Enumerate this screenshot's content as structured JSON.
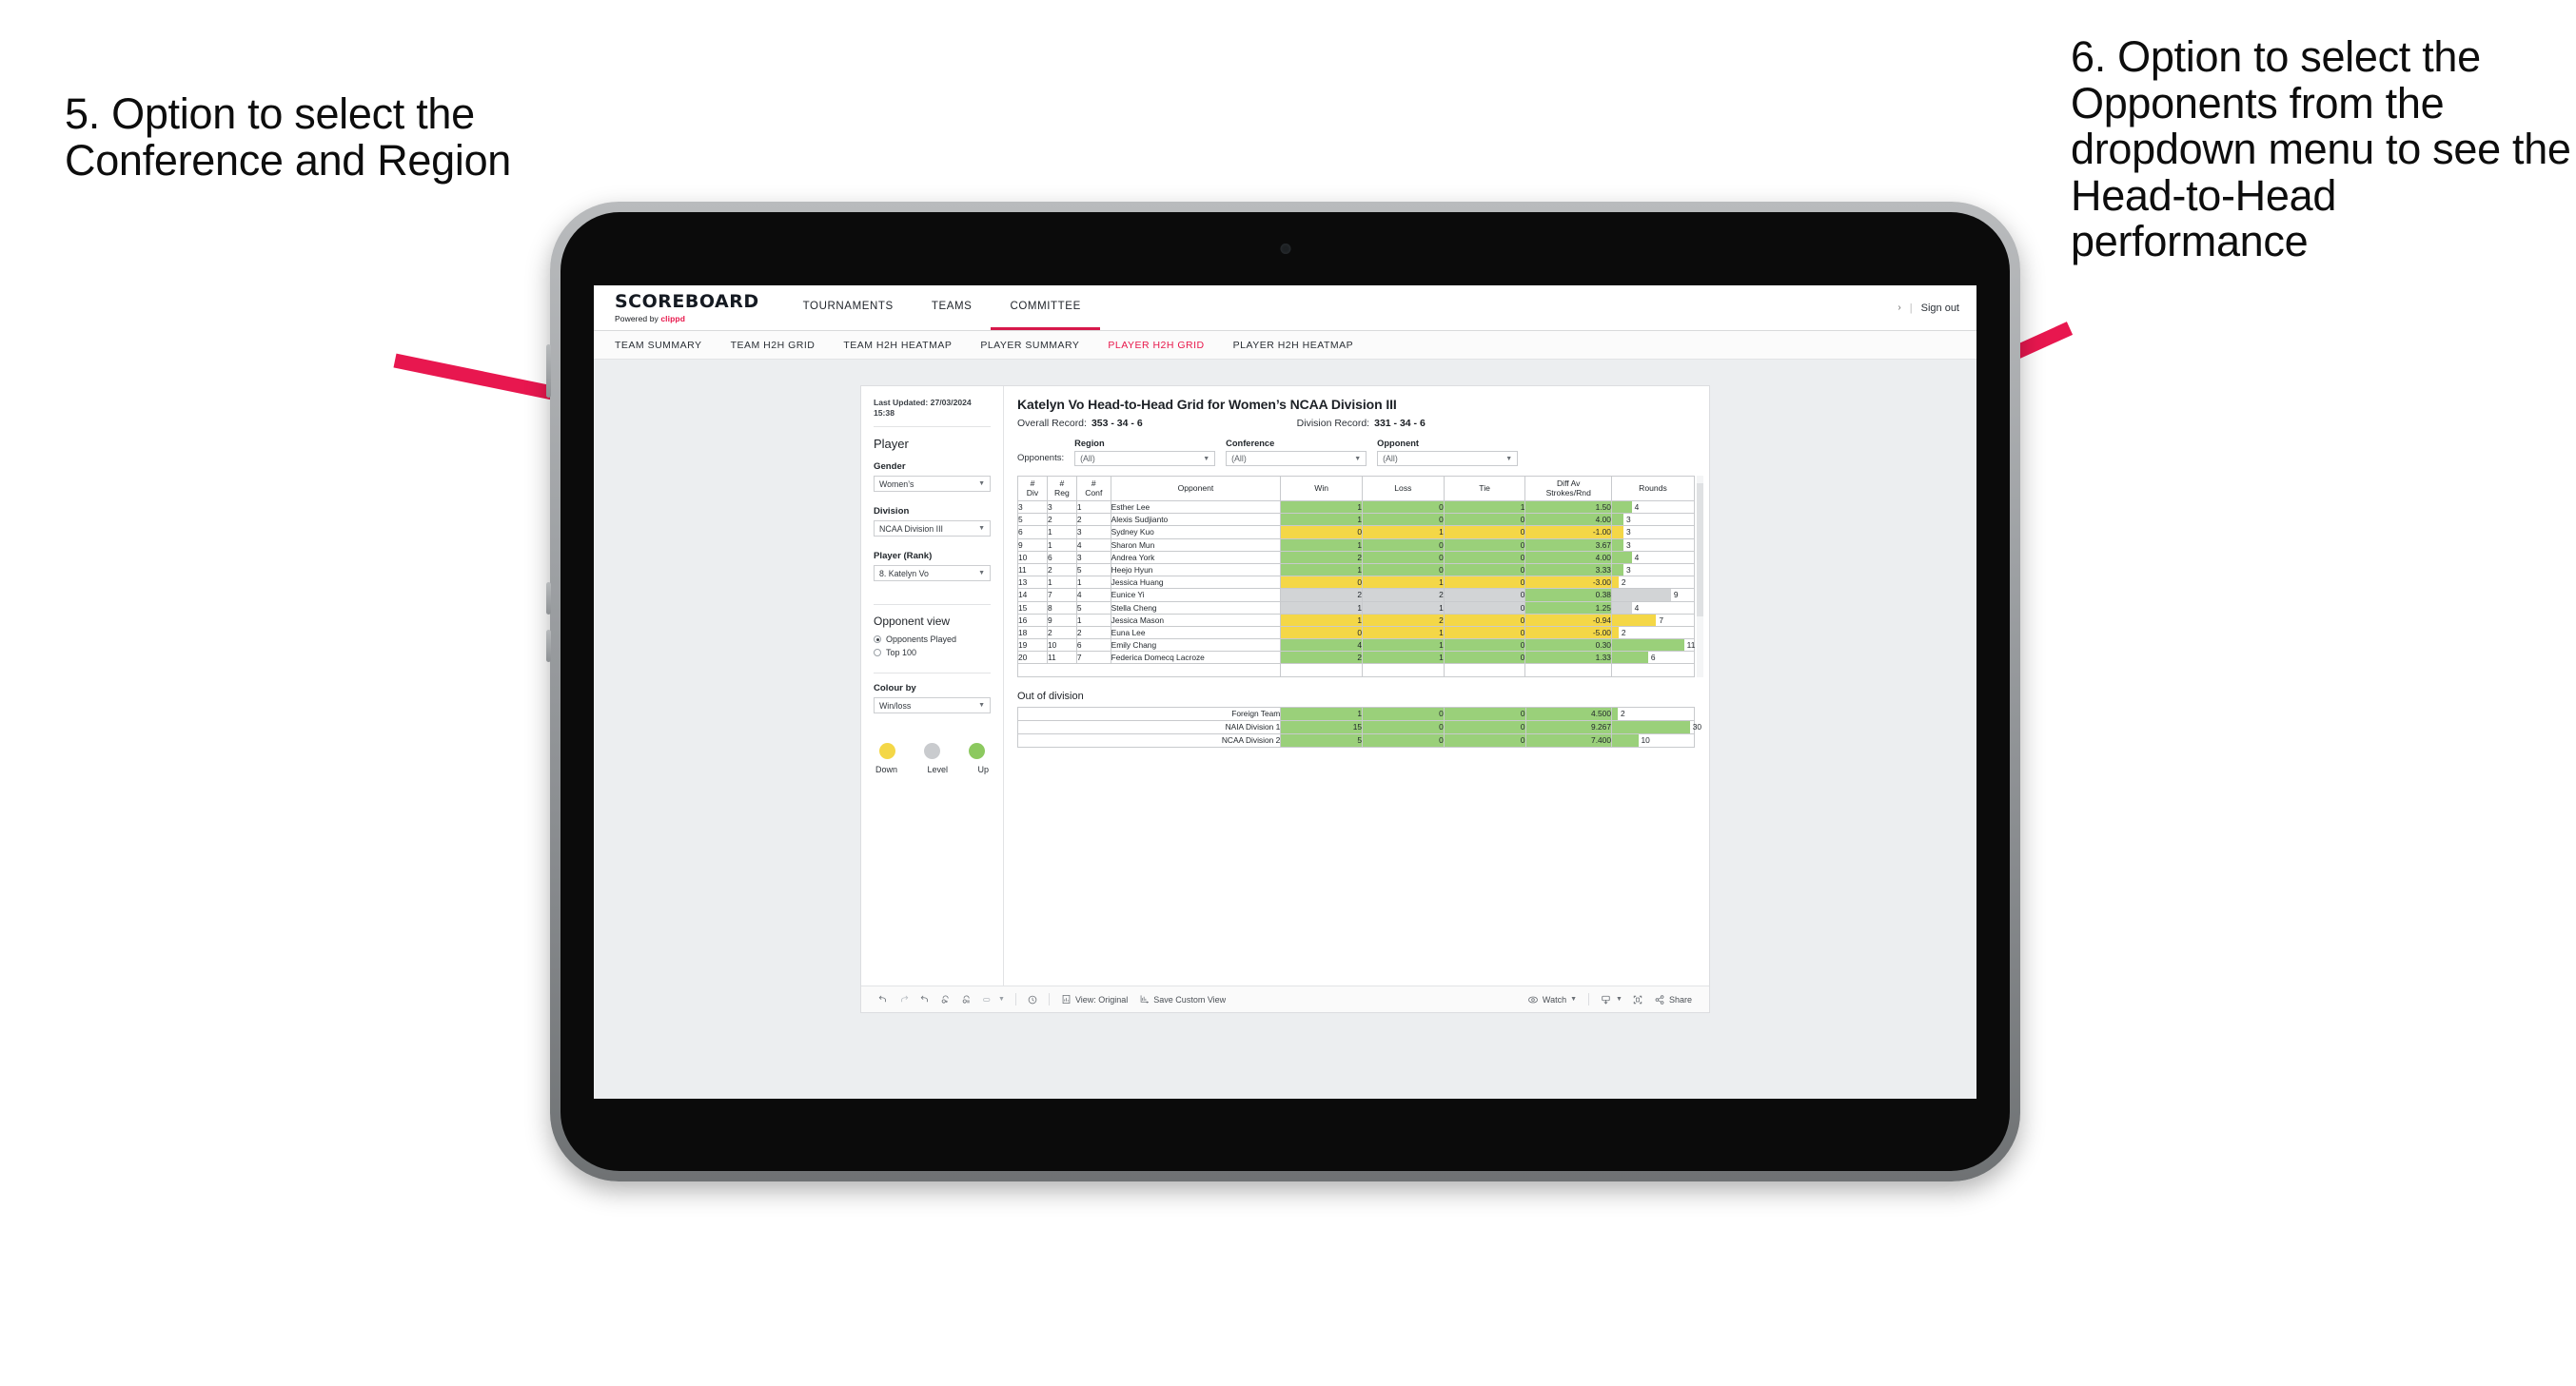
{
  "annotations": {
    "left": "5. Option to select the Conference and Region",
    "right": "6. Option to select the Opponents from the dropdown menu to see the Head-to-Head performance",
    "arrow_color": "#e8174f"
  },
  "app": {
    "brand": {
      "name": "SCOREBOARD",
      "powered_prefix": "Powered by ",
      "powered_brand": "clippd"
    },
    "topnav": [
      {
        "label": "TOURNAMENTS",
        "active": false
      },
      {
        "label": "TEAMS",
        "active": false
      },
      {
        "label": "COMMITTEE",
        "active": true
      }
    ],
    "top_right": {
      "chevron": "›",
      "divider": "|",
      "signout": "Sign out"
    },
    "subnav": [
      {
        "label": "TEAM SUMMARY",
        "active": false
      },
      {
        "label": "TEAM H2H GRID",
        "active": false
      },
      {
        "label": "TEAM H2H HEATMAP",
        "active": false
      },
      {
        "label": "PLAYER SUMMARY",
        "active": false
      },
      {
        "label": "PLAYER H2H GRID",
        "active": true
      },
      {
        "label": "PLAYER H2H HEATMAP",
        "active": false
      }
    ],
    "accent": "#e8174b"
  },
  "sidebar": {
    "last_updated": "Last Updated: 27/03/2024 15:38",
    "section_player": "Player",
    "fields": [
      {
        "label": "Gender",
        "value": "Women’s"
      },
      {
        "label": "Division",
        "value": "NCAA Division III"
      },
      {
        "label": "Player (Rank)",
        "value": "8. Katelyn Vo"
      }
    ],
    "opponent_view": {
      "title": "Opponent view",
      "options": [
        {
          "label": "Opponents Played",
          "selected": true
        },
        {
          "label": "Top 100",
          "selected": false
        }
      ]
    },
    "colour_by": {
      "label": "Colour by",
      "value": "Win/loss"
    },
    "legend": [
      {
        "label": "Down",
        "color": "#f4d747"
      },
      {
        "label": "Level",
        "color": "#c9cbce"
      },
      {
        "label": "Up",
        "color": "#8cc95f"
      }
    ]
  },
  "main": {
    "title": "Katelyn Vo Head-to-Head Grid for Women’s NCAA Division III",
    "overall_label": "Overall Record:",
    "overall_value": "353 - 34 - 6",
    "division_label": "Division Record:",
    "division_value": "331 -  34 - 6",
    "opponents_label": "Opponents:",
    "filters": [
      {
        "label": "Region",
        "value": "(All)"
      },
      {
        "label": "Conference",
        "value": "(All)"
      },
      {
        "label": "Opponent",
        "value": "(All)"
      }
    ]
  },
  "chart_data": {
    "type": "table",
    "title": "Katelyn Vo Head-to-Head Grid for Women’s NCAA Division III",
    "columns": [
      "# Div",
      "# Reg",
      "# Conf",
      "Opponent",
      "Win",
      "Loss",
      "Tie",
      "Diff Av Strokes/Rnd",
      "Rounds"
    ],
    "column_header_lines": [
      [
        "#",
        "Div"
      ],
      [
        "#",
        "Reg"
      ],
      [
        "#",
        "Conf"
      ],
      [
        "Opponent"
      ],
      [
        "Win"
      ],
      [
        "Loss"
      ],
      [
        "Tie"
      ],
      [
        "Diff Av",
        "Strokes/Rnd"
      ],
      [
        "Rounds"
      ]
    ],
    "rows": [
      {
        "div": "3",
        "reg": "3",
        "conf": "1",
        "opponent": "Esther Lee",
        "win": "1",
        "loss": "0",
        "tie": "1",
        "diff": "1.50",
        "rounds": "4",
        "state": "up",
        "bar_pct": 24
      },
      {
        "div": "5",
        "reg": "2",
        "conf": "2",
        "opponent": "Alexis Sudjianto",
        "win": "1",
        "loss": "0",
        "tie": "0",
        "diff": "4.00",
        "rounds": "3",
        "state": "up",
        "bar_pct": 14
      },
      {
        "div": "6",
        "reg": "1",
        "conf": "3",
        "opponent": "Sydney Kuo",
        "win": "0",
        "loss": "1",
        "tie": "0",
        "diff": "-1.00",
        "rounds": "3",
        "state": "down",
        "bar_pct": 14
      },
      {
        "div": "9",
        "reg": "1",
        "conf": "4",
        "opponent": "Sharon Mun",
        "win": "1",
        "loss": "0",
        "tie": "0",
        "diff": "3.67",
        "rounds": "3",
        "state": "up",
        "bar_pct": 14
      },
      {
        "div": "10",
        "reg": "6",
        "conf": "3",
        "opponent": "Andrea York",
        "win": "2",
        "loss": "0",
        "tie": "0",
        "diff": "4.00",
        "rounds": "4",
        "state": "up",
        "bar_pct": 24
      },
      {
        "div": "11",
        "reg": "2",
        "conf": "5",
        "opponent": "Heejo Hyun",
        "win": "1",
        "loss": "0",
        "tie": "0",
        "diff": "3.33",
        "rounds": "3",
        "state": "up",
        "bar_pct": 14
      },
      {
        "div": "13",
        "reg": "1",
        "conf": "1",
        "opponent": "Jessica Huang",
        "win": "0",
        "loss": "1",
        "tie": "0",
        "diff": "-3.00",
        "rounds": "2",
        "state": "down",
        "bar_pct": 8
      },
      {
        "div": "14",
        "reg": "7",
        "conf": "4",
        "opponent": "Eunice Yi",
        "win": "2",
        "loss": "2",
        "tie": "0",
        "diff": "0.38",
        "rounds": "9",
        "state": "level",
        "bar_pct": 72,
        "diff_state": "up"
      },
      {
        "div": "15",
        "reg": "8",
        "conf": "5",
        "opponent": "Stella Cheng",
        "win": "1",
        "loss": "1",
        "tie": "0",
        "diff": "1.25",
        "rounds": "4",
        "state": "level",
        "bar_pct": 24,
        "diff_state": "up"
      },
      {
        "div": "16",
        "reg": "9",
        "conf": "1",
        "opponent": "Jessica Mason",
        "win": "1",
        "loss": "2",
        "tie": "0",
        "diff": "-0.94",
        "rounds": "7",
        "state": "down",
        "bar_pct": 54
      },
      {
        "div": "18",
        "reg": "2",
        "conf": "2",
        "opponent": "Euna Lee",
        "win": "0",
        "loss": "1",
        "tie": "0",
        "diff": "-5.00",
        "rounds": "2",
        "state": "down",
        "bar_pct": 8
      },
      {
        "div": "19",
        "reg": "10",
        "conf": "6",
        "opponent": "Emily Chang",
        "win": "4",
        "loss": "1",
        "tie": "0",
        "diff": "0.30",
        "rounds": "11",
        "state": "up",
        "bar_pct": 88
      },
      {
        "div": "20",
        "reg": "11",
        "conf": "7",
        "opponent": "Federica Domecq Lacroze",
        "win": "2",
        "loss": "1",
        "tie": "0",
        "diff": "1.33",
        "rounds": "6",
        "state": "up",
        "bar_pct": 44
      }
    ],
    "out_of_division": {
      "title": "Out of division",
      "rows": [
        {
          "name": "Foreign Team",
          "win": "1",
          "loss": "0",
          "tie": "0",
          "diff": "4.500",
          "rounds": "2",
          "state": "up",
          "bar_pct": 7
        },
        {
          "name": "NAIA Division 1",
          "win": "15",
          "loss": "0",
          "tie": "0",
          "diff": "9.267",
          "rounds": "30",
          "state": "up",
          "bar_pct": 95
        },
        {
          "name": "NCAA Division 2",
          "win": "5",
          "loss": "0",
          "tie": "0",
          "diff": "7.400",
          "rounds": "10",
          "state": "up",
          "bar_pct": 32
        }
      ]
    },
    "colors": {
      "up": "#9ad07a",
      "down": "#f4d747",
      "level": "#d2d4d6"
    }
  },
  "toolbar": {
    "items": [
      {
        "name": "undo",
        "label": ""
      },
      {
        "name": "redo",
        "label": ""
      },
      {
        "name": "revert",
        "label": ""
      },
      {
        "name": "refresh",
        "label": ""
      },
      {
        "name": "pause",
        "label": ""
      },
      {
        "name": "alerts",
        "label": ""
      },
      {
        "name": "highlight",
        "label": ""
      },
      {
        "name": "view-original",
        "label": "View: Original"
      },
      {
        "name": "save-custom-view",
        "label": "Save Custom View"
      },
      {
        "name": "watch",
        "label": "Watch"
      },
      {
        "name": "download",
        "label": ""
      },
      {
        "name": "fullscreen",
        "label": ""
      },
      {
        "name": "share",
        "label": "Share"
      }
    ],
    "view_original": "View: Original",
    "save_custom_view": "Save Custom View",
    "watch": "Watch",
    "share": "Share"
  }
}
